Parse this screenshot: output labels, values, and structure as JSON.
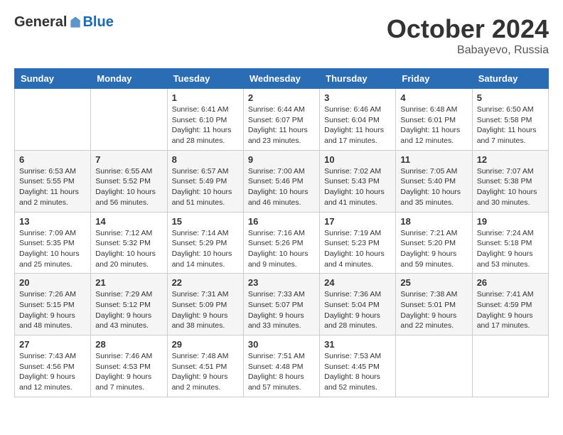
{
  "header": {
    "logo": {
      "general": "General",
      "blue": "Blue"
    },
    "title": "October 2024",
    "location": "Babayevo, Russia"
  },
  "weekdays": [
    "Sunday",
    "Monday",
    "Tuesday",
    "Wednesday",
    "Thursday",
    "Friday",
    "Saturday"
  ],
  "weeks": [
    [
      {
        "day": null,
        "info": null
      },
      {
        "day": null,
        "info": null
      },
      {
        "day": "1",
        "info": "Sunrise: 6:41 AM\nSunset: 6:10 PM\nDaylight: 11 hours\nand 28 minutes."
      },
      {
        "day": "2",
        "info": "Sunrise: 6:44 AM\nSunset: 6:07 PM\nDaylight: 11 hours\nand 23 minutes."
      },
      {
        "day": "3",
        "info": "Sunrise: 6:46 AM\nSunset: 6:04 PM\nDaylight: 11 hours\nand 17 minutes."
      },
      {
        "day": "4",
        "info": "Sunrise: 6:48 AM\nSunset: 6:01 PM\nDaylight: 11 hours\nand 12 minutes."
      },
      {
        "day": "5",
        "info": "Sunrise: 6:50 AM\nSunset: 5:58 PM\nDaylight: 11 hours\nand 7 minutes."
      }
    ],
    [
      {
        "day": "6",
        "info": "Sunrise: 6:53 AM\nSunset: 5:55 PM\nDaylight: 11 hours\nand 2 minutes."
      },
      {
        "day": "7",
        "info": "Sunrise: 6:55 AM\nSunset: 5:52 PM\nDaylight: 10 hours\nand 56 minutes."
      },
      {
        "day": "8",
        "info": "Sunrise: 6:57 AM\nSunset: 5:49 PM\nDaylight: 10 hours\nand 51 minutes."
      },
      {
        "day": "9",
        "info": "Sunrise: 7:00 AM\nSunset: 5:46 PM\nDaylight: 10 hours\nand 46 minutes."
      },
      {
        "day": "10",
        "info": "Sunrise: 7:02 AM\nSunset: 5:43 PM\nDaylight: 10 hours\nand 41 minutes."
      },
      {
        "day": "11",
        "info": "Sunrise: 7:05 AM\nSunset: 5:40 PM\nDaylight: 10 hours\nand 35 minutes."
      },
      {
        "day": "12",
        "info": "Sunrise: 7:07 AM\nSunset: 5:38 PM\nDaylight: 10 hours\nand 30 minutes."
      }
    ],
    [
      {
        "day": "13",
        "info": "Sunrise: 7:09 AM\nSunset: 5:35 PM\nDaylight: 10 hours\nand 25 minutes."
      },
      {
        "day": "14",
        "info": "Sunrise: 7:12 AM\nSunset: 5:32 PM\nDaylight: 10 hours\nand 20 minutes."
      },
      {
        "day": "15",
        "info": "Sunrise: 7:14 AM\nSunset: 5:29 PM\nDaylight: 10 hours\nand 14 minutes."
      },
      {
        "day": "16",
        "info": "Sunrise: 7:16 AM\nSunset: 5:26 PM\nDaylight: 10 hours\nand 9 minutes."
      },
      {
        "day": "17",
        "info": "Sunrise: 7:19 AM\nSunset: 5:23 PM\nDaylight: 10 hours\nand 4 minutes."
      },
      {
        "day": "18",
        "info": "Sunrise: 7:21 AM\nSunset: 5:20 PM\nDaylight: 9 hours\nand 59 minutes."
      },
      {
        "day": "19",
        "info": "Sunrise: 7:24 AM\nSunset: 5:18 PM\nDaylight: 9 hours\nand 53 minutes."
      }
    ],
    [
      {
        "day": "20",
        "info": "Sunrise: 7:26 AM\nSunset: 5:15 PM\nDaylight: 9 hours\nand 48 minutes."
      },
      {
        "day": "21",
        "info": "Sunrise: 7:29 AM\nSunset: 5:12 PM\nDaylight: 9 hours\nand 43 minutes."
      },
      {
        "day": "22",
        "info": "Sunrise: 7:31 AM\nSunset: 5:09 PM\nDaylight: 9 hours\nand 38 minutes."
      },
      {
        "day": "23",
        "info": "Sunrise: 7:33 AM\nSunset: 5:07 PM\nDaylight: 9 hours\nand 33 minutes."
      },
      {
        "day": "24",
        "info": "Sunrise: 7:36 AM\nSunset: 5:04 PM\nDaylight: 9 hours\nand 28 minutes."
      },
      {
        "day": "25",
        "info": "Sunrise: 7:38 AM\nSunset: 5:01 PM\nDaylight: 9 hours\nand 22 minutes."
      },
      {
        "day": "26",
        "info": "Sunrise: 7:41 AM\nSunset: 4:59 PM\nDaylight: 9 hours\nand 17 minutes."
      }
    ],
    [
      {
        "day": "27",
        "info": "Sunrise: 7:43 AM\nSunset: 4:56 PM\nDaylight: 9 hours\nand 12 minutes."
      },
      {
        "day": "28",
        "info": "Sunrise: 7:46 AM\nSunset: 4:53 PM\nDaylight: 9 hours\nand 7 minutes."
      },
      {
        "day": "29",
        "info": "Sunrise: 7:48 AM\nSunset: 4:51 PM\nDaylight: 9 hours\nand 2 minutes."
      },
      {
        "day": "30",
        "info": "Sunrise: 7:51 AM\nSunset: 4:48 PM\nDaylight: 8 hours\nand 57 minutes."
      },
      {
        "day": "31",
        "info": "Sunrise: 7:53 AM\nSunset: 4:45 PM\nDaylight: 8 hours\nand 52 minutes."
      },
      {
        "day": null,
        "info": null
      },
      {
        "day": null,
        "info": null
      }
    ]
  ]
}
